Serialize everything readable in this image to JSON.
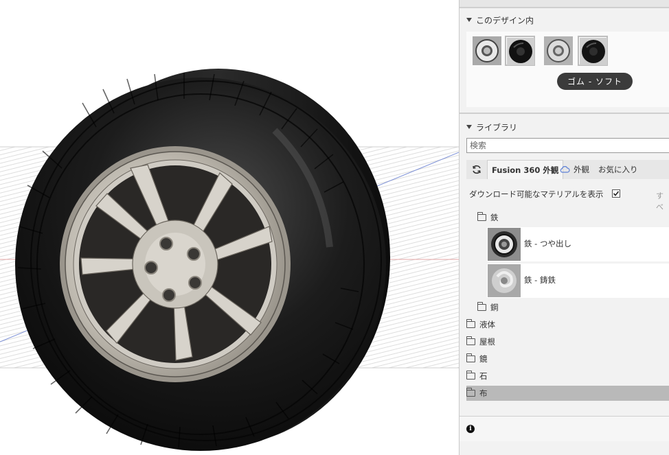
{
  "panel": {
    "design_section": {
      "title": "このデザイン内"
    },
    "tooltip": "ゴム - ソフト",
    "library_section": {
      "title": "ライブラリ"
    },
    "search": {
      "placeholder": "検索"
    },
    "tabs": [
      {
        "label": "Fusion 360 外観",
        "active": true
      },
      {
        "label": "外観",
        "active": false
      },
      {
        "label": "お気に入り",
        "active": false
      }
    ],
    "download_toggle": {
      "label": "ダウンロード可能なマテリアルを表示",
      "checked": true
    },
    "more_link": "すべ",
    "tree": {
      "iron_folder": "鉄",
      "iron_materials": [
        {
          "label": "鉄 - つや出し"
        },
        {
          "label": "鉄 - 鋳鉄"
        }
      ],
      "steel_folder": "鋼",
      "folders": [
        "液体",
        "屋根",
        "鏡",
        "石",
        "布"
      ]
    }
  },
  "colors": {
    "accent_blue": "#5b7fd6",
    "selection_gray": "#b9b9b9"
  }
}
